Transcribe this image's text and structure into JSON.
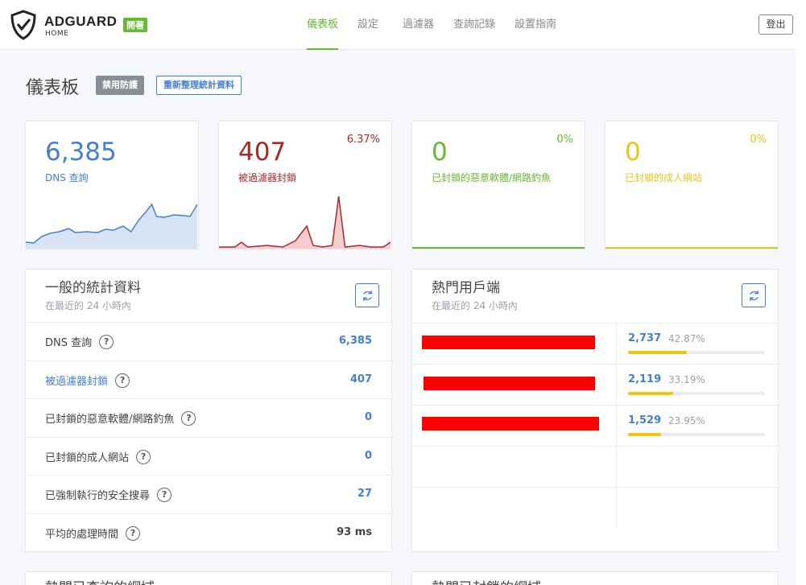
{
  "header": {
    "brand": "ADGUARD",
    "brand_sub": "HOME",
    "status_badge": "開著",
    "nav": [
      "儀表板",
      "設定",
      "過濾器",
      "查詢記錄",
      "設置指南"
    ],
    "logout_label": "登出"
  },
  "page": {
    "title": "儀表板",
    "disable_label": "禁用防護",
    "refresh_label": "重新整理統計資料"
  },
  "stat_cards": [
    {
      "value": "6,385",
      "label": "DNS 查詢",
      "percent": "",
      "color": "#467fcf"
    },
    {
      "value": "407",
      "label": "被過濾器封鎖",
      "percent": "6.37%",
      "color": "#a52a2a"
    },
    {
      "value": "0",
      "label": "已封鎖的惡意軟體/網路釣魚",
      "percent": "0%",
      "color": "#67b930"
    },
    {
      "value": "0",
      "label": "已封鎖的成人網站",
      "percent": "0%",
      "color": "#e5c51c"
    }
  ],
  "general": {
    "title": "一般的統計資料",
    "subtitle": "在最近的 24 小時內",
    "rows": [
      {
        "label": "DNS 查詢",
        "value": "6,385",
        "value_color": "#467fcf"
      },
      {
        "label": "被過濾器封鎖",
        "value": "407",
        "value_color": "#467fcf"
      },
      {
        "label": "已封鎖的惡意軟體/網路釣魚",
        "value": "0",
        "value_color": "#467fcf"
      },
      {
        "label": "已封鎖的成人網站",
        "value": "0",
        "value_color": "#467fcf"
      },
      {
        "label": "已強制執行的安全搜尋",
        "value": "27",
        "value_color": "#467fcf"
      },
      {
        "label": "平均的處理時間",
        "value": "93 ms",
        "value_color": "#444444"
      }
    ]
  },
  "clients": {
    "title": "熱門用戶端",
    "subtitle": "在最近的 24 小時內",
    "rows": [
      {
        "count": "2,737",
        "percent": "42.87%",
        "fraction": 0.4287
      },
      {
        "count": "2,119",
        "percent": "33.19%",
        "fraction": 0.3319
      },
      {
        "count": "1,529",
        "percent": "23.95%",
        "fraction": 0.2395
      }
    ]
  },
  "bottom": {
    "left_title": "熱門已查詢的網域",
    "right_title": "熱門已封鎖的網域"
  },
  "colors": {
    "accent": "#67b930",
    "primary": "#467fcf",
    "blocked": "#a52a2a",
    "warning": "#f1c40f"
  }
}
